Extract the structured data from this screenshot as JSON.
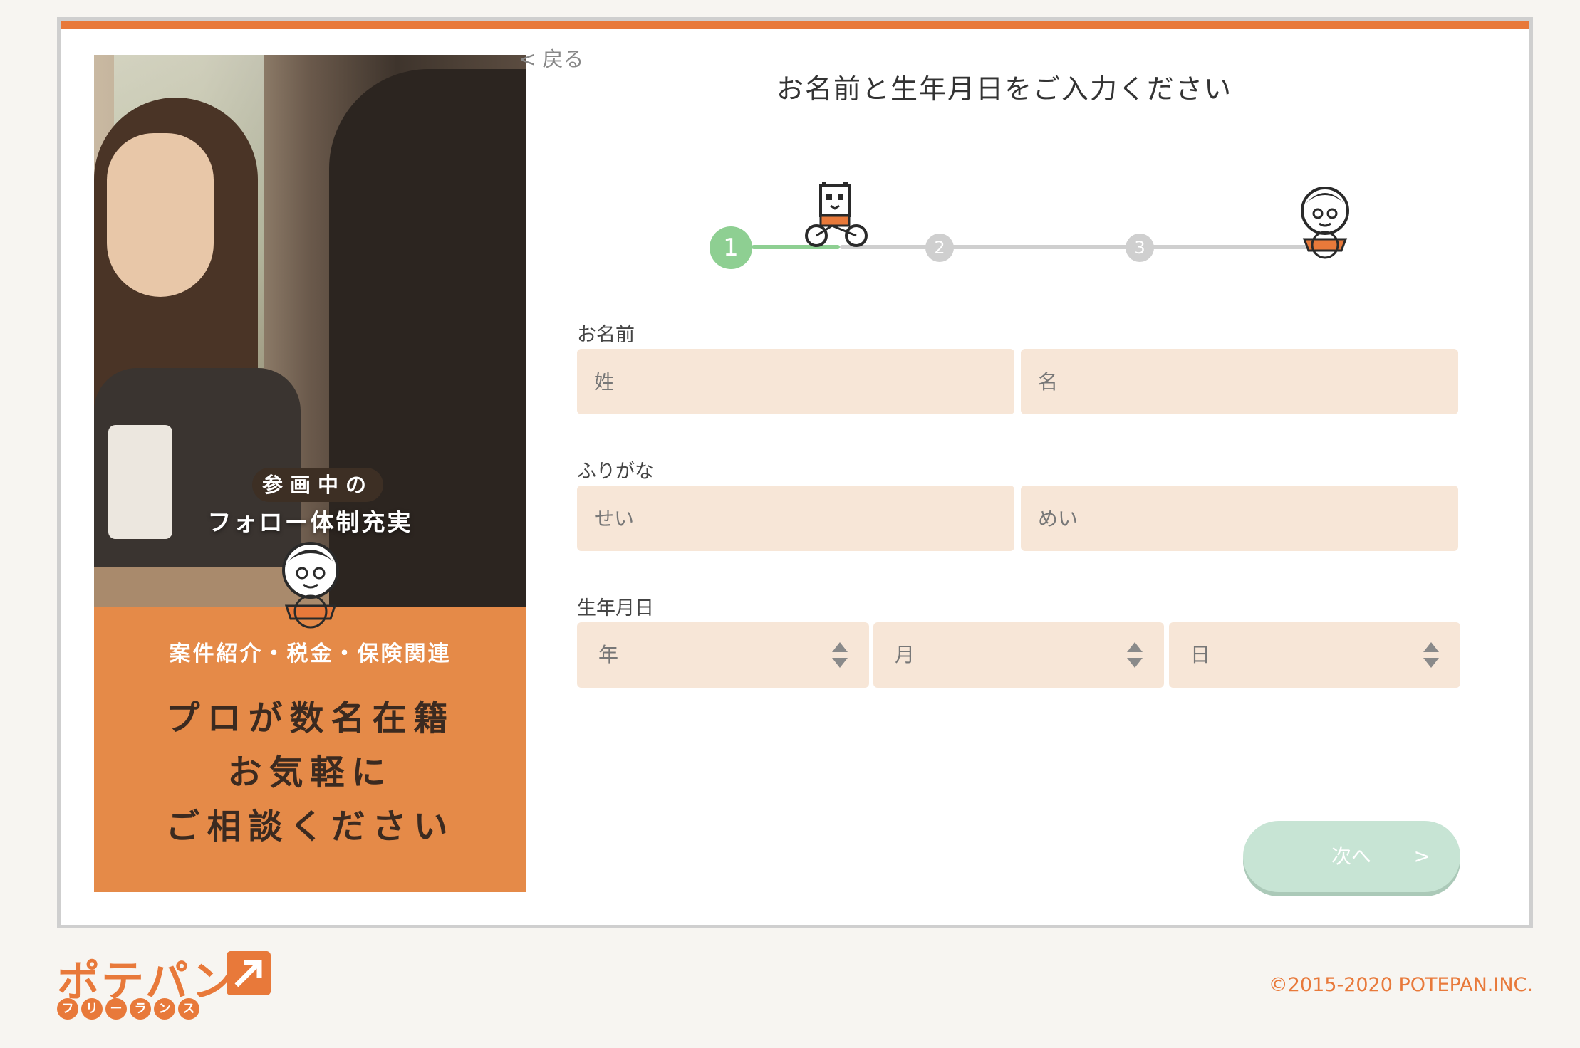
{
  "back": "< 戻る",
  "title": "お名前と生年月日をご入力ください",
  "progress": {
    "current": 1,
    "steps": [
      "1",
      "2",
      "3"
    ]
  },
  "form": {
    "name_label": "お名前",
    "last_name_placeholder": "姓",
    "first_name_placeholder": "名",
    "kana_label": "ふりがな",
    "last_kana_placeholder": "せい",
    "first_kana_placeholder": "めい",
    "birth_label": "生年月日",
    "year_placeholder": "年",
    "month_placeholder": "月",
    "day_placeholder": "日"
  },
  "next_button": {
    "label": "次へ",
    "chevron": ">"
  },
  "promo": {
    "badge": "参画中の",
    "sub": "フォロー体制充実",
    "categories": "案件紹介・税金・保険関連",
    "headline": [
      "プロが数名在籍",
      "お気軽に",
      "ご相談ください"
    ]
  },
  "footer": {
    "logo": "ポテパン",
    "logo_sub": [
      "フ",
      "リ",
      "ー",
      "ラ",
      "ン",
      "ス"
    ],
    "copyright": "©2015-2020 POTEPAN.INC."
  },
  "colors": {
    "accent": "#e8793a",
    "field_bg": "#f7e6d7",
    "progress_done": "#8ecf92",
    "button_disabled": "#c7e4d4"
  }
}
